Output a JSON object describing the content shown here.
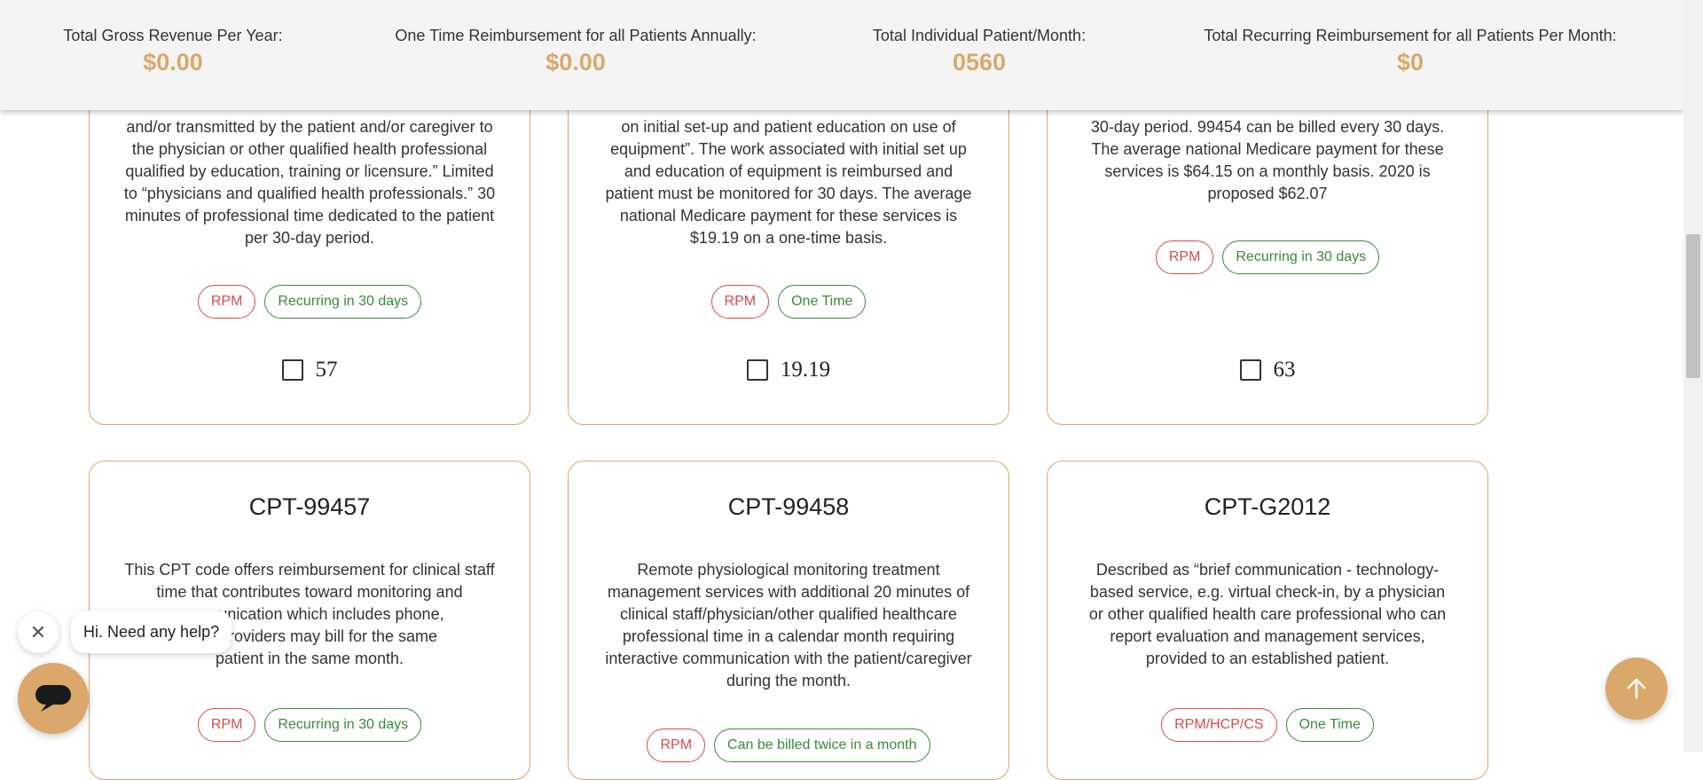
{
  "summary": {
    "gross_revenue_label": "Total Gross Revenue Per Year:",
    "gross_revenue_value": "$0.00",
    "one_time_label": "One Time Reimbursement for all Patients Annually:",
    "one_time_value": "$0.00",
    "individual_label": "Total Individual Patient/Month:",
    "individual_value": "0560",
    "recurring_label": "Total Recurring Reimbursement for all Patients Per Month:",
    "recurring_value": "$0"
  },
  "cards": [
    {
      "lines": [
        "and/or transmitted by the patient and/or caregiver to",
        "the physician or other qualified health professional",
        "qualified by education, training or licensure.” Limited",
        "to “physicians and qualified health professionals.” 30",
        "minutes of professional time dedicated to the patient",
        "per 30-day period."
      ],
      "tag1": "RPM",
      "tag2": "Recurring in 30 days",
      "price": "57"
    },
    {
      "lines": [
        "on initial set-up and patient education on use of",
        "equipment”. The work associated with initial set up",
        "and education of equipment is reimbursed and",
        "patient must be monitored for 30 days. The average",
        "national Medicare payment for these services is",
        "$19.19 on a one-time basis."
      ],
      "tag1": "RPM",
      "tag2": "One Time",
      "price": "19.19"
    },
    {
      "lines": [
        "30-day period. 99454 can be billed every 30 days.",
        "The average national Medicare payment for these",
        "services is $64.15 on a monthly basis. 2020 is",
        "proposed $62.07"
      ],
      "tag1": "RPM",
      "tag2": "Recurring in 30 days",
      "price": "63"
    },
    {
      "title": "CPT-99457",
      "lines": [
        "This CPT code offers reimbursement for clinical staff",
        "time that contributes toward monitoring and",
        "communication which includes phone,",
        "ail. 2 providers may bill for the same",
        "patient in the same month."
      ],
      "tag1": "RPM",
      "tag2": "Recurring in 30 days"
    },
    {
      "title": "CPT-99458",
      "lines": [
        "Remote physiological monitoring treatment",
        "management services with additional 20 minutes of",
        "clinical staff/physician/other qualified healthcare",
        "professional time in a calendar month requiring",
        "interactive communication with the patient/caregiver",
        "during the month."
      ],
      "tag1": "RPM",
      "tag2": "Can be billed twice in a month"
    },
    {
      "title": "CPT-G2012",
      "lines": [
        "Described as “brief communication - technology-",
        "based service, e.g. virtual check-in, by a physician",
        "or other qualified health care professional who can",
        "report evaluation and management services,",
        "provided to an established patient."
      ],
      "tag1": "RPM/HCP/CS",
      "tag2": "One Time"
    }
  ],
  "chat": {
    "greeting": "Hi. Need any help?",
    "close_glyph": "✕"
  },
  "colors": {
    "accent": "#d9a86a",
    "tag_red": "#d94a4a",
    "tag_green": "#3a8a3a"
  }
}
